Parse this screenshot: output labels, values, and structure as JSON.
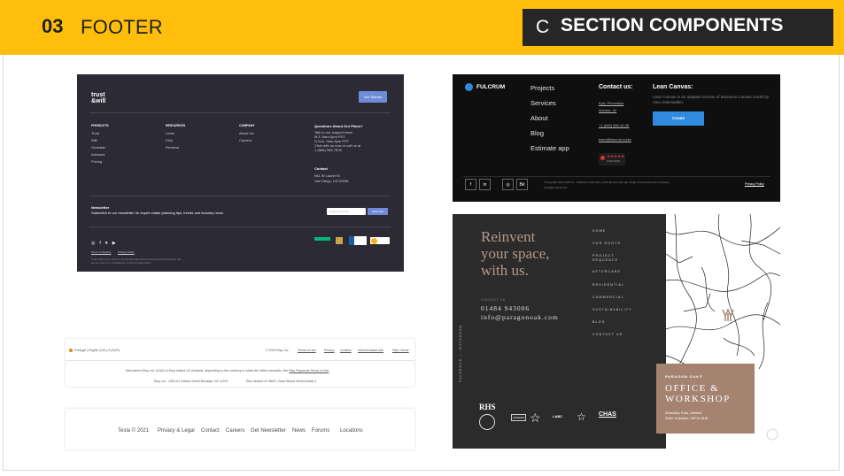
{
  "header": {
    "number": "03",
    "title": "FOOTER",
    "tag_letter": "C",
    "tag_text": "SECTION COMPONENTS",
    "band_color": "#ffbe0b",
    "tag_bg": "#262626"
  },
  "trust_will": {
    "logo_line1": "trust",
    "logo_line2": "&will",
    "get_started": "Get Started",
    "products_heading": "PRODUCTS",
    "products": [
      "Trust",
      "Will",
      "Guardian",
      "Advisors",
      "Pricing"
    ],
    "resources_heading": "RESOURCES",
    "resources": [
      "Learn",
      "FAQ",
      "Reviews"
    ],
    "company_heading": "COMPANY",
    "company": [
      "About Us",
      "Careers"
    ],
    "questions_heading": "Questions About Our Plans?",
    "questions_lines": [
      "Talk to our support team",
      "M-F, 8am-5pm PST",
      "S-Sun, 9am-5pm PST",
      "Chat with us now or call us at",
      "1 (866) 908-7878"
    ],
    "contact_heading": "Contact",
    "contact_lines": [
      "961 W Laurel St",
      "San Diego, CA 92336"
    ],
    "newsletter_heading": "Newsletter",
    "newsletter_text": "Subscribe to our newsletter for expert estate planning tips, trends and industry news.",
    "email_placeholder": "Enter your email",
    "subscribe": "Subscribe",
    "social_icons": [
      "instagram-icon",
      "facebook-icon",
      "twitter-icon",
      "youtube-icon"
    ],
    "legal_links": [
      "Terms of Service",
      "Privacy Policy"
    ],
    "disclaimer_line1": "Trust & Will is not a law firm, not providing legal advice but does provide information. We",
    "disclaimer_line2": "are not a law firm or substitute for a practicing legal advisor.",
    "accent": "#6f8bd7",
    "bg": "#2b2a35"
  },
  "fulcrum": {
    "brand": "FULCRUM",
    "nav": [
      "Projects",
      "Services",
      "About",
      "Blog",
      "Estimate app"
    ],
    "contact_heading": "Contact us:",
    "address": [
      "Kyiv, Pevnetska",
      "Avenue, 42"
    ],
    "phone": "+1 (646) 980-42-36",
    "email": "team@fulcrum.rocks",
    "rating_stars": "★★★★★",
    "rating_label": "18 REVIEWS",
    "lean_heading": "Lean Canvas:",
    "lean_text": "Lean Canvas is an adapted version of Business Canvas model by Alex Osterwalder.",
    "create": "Create",
    "socials": [
      "f",
      "in",
      "◎",
      "Bē"
    ],
    "copyright_line1": "©Copyright 2021 Fulcrum - fullstack mobile (iOS, Android) and web app design and development company.",
    "copyright_line2": "All Rights Reserved",
    "privacy": "Privacy Policy",
    "accent": "#2e8bde"
  },
  "paragon": {
    "headline": [
      "Reinvent",
      "your space,",
      "with us."
    ],
    "nav": [
      "HOME",
      "OUR ROOTS",
      "PROJECT",
      "SEQUENCE",
      "AFTERCARE",
      "RESIDENTIAL",
      "COMMERCIAL",
      "SUSTAINABILITY",
      "BLOG",
      "CONTACT US"
    ],
    "contact_label": "CONTACT US",
    "phone": "01484 943006",
    "email": "info@paragonoak.com",
    "vertical_social": "FACEBOOK — INSTAGRAM",
    "card_brand": "PARAGON OAK®",
    "card_title1": "OFFICE &",
    "card_title2": "WORKSHOP",
    "card_addr1": "Wheatley Park, Mirfield",
    "card_addr2": "West Yorkshire, WF14 8HE",
    "logos": [
      "RHS",
      "AWARDS",
      "LABC",
      "CHAS"
    ],
    "headline_color": "#b59a88",
    "card_color": "#a58371"
  },
  "strip_footer": {
    "locale": "Portugal | English (US) | € (EUR)",
    "copyright": "© 2023 Etsy, Inc.",
    "links": [
      "Terms of Use",
      "Privacy",
      "Cookies",
      "Interest-based ads",
      "Help Centre"
    ],
    "line2": "Merchant is Etsy, Inc. (USA) or Etsy Ireland UC (Ireland), depending on the currency in which the Seller transacts. See",
    "line2_link": "Etsy Payments Terms of Use",
    "line3_a": "Etsy, Inc., USA 117 Adams Street Brooklyn, NY 11201",
    "line3_b": "Etsy Ireland UC 66/67 Great Strand Street Dublin 1"
  },
  "tesla": {
    "items": [
      "Tesla © 2021",
      "Privacy & Legal",
      "Contact",
      "Careers",
      "Get Newsletter",
      "News",
      "Forums",
      "Locations"
    ]
  }
}
